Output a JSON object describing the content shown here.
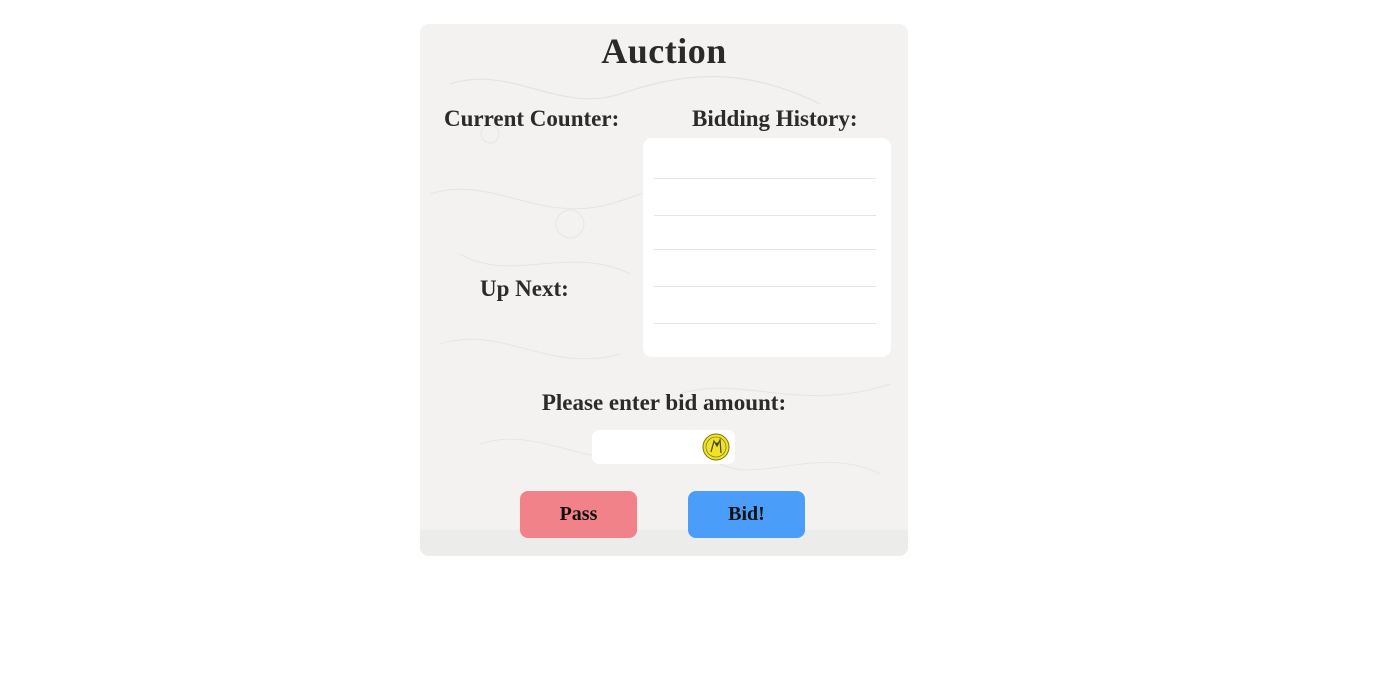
{
  "auction": {
    "title": "Auction",
    "current_counter_label": "Current Counter:",
    "bidding_history_label": "Bidding History:",
    "up_next_label": "Up Next:",
    "bid_prompt": "Please enter bid amount:",
    "bid_input": {
      "value": "",
      "placeholder": ""
    },
    "bidding_history": [
      "",
      "",
      "",
      "",
      "",
      ""
    ],
    "buttons": {
      "pass_label": "Pass",
      "bid_label": "Bid!"
    },
    "icons": {
      "currency": "coin-icon"
    },
    "colors": {
      "pass_button": "#f1828a",
      "bid_button": "#4a9df8",
      "panel_background": "#f3f2f0",
      "coin": "#efe22a"
    }
  }
}
